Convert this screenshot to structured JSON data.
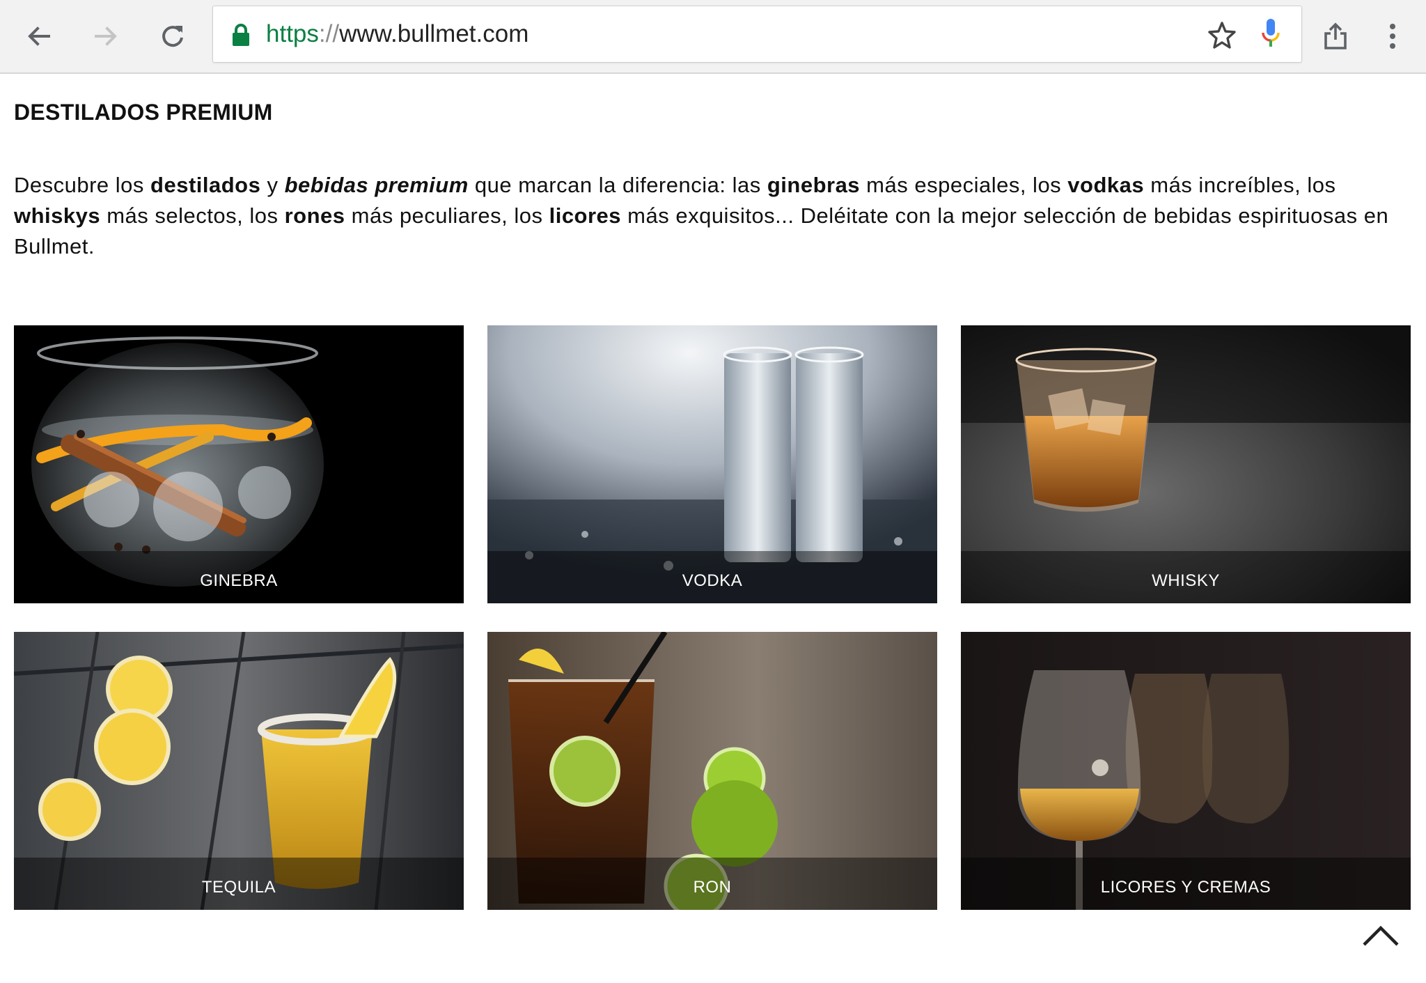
{
  "browser": {
    "url_scheme": "https",
    "url_separator": "://",
    "url_host": "www.bullmet.com",
    "icons": {
      "back": "arrow-left",
      "forward": "arrow-right",
      "reload": "refresh",
      "lock": "padlock",
      "bookmark": "star-outline",
      "voice": "microphone",
      "share": "share-up",
      "menu": "three-dots-vertical"
    },
    "colors": {
      "secure": "#0b8043",
      "toolbar_bg": "#f2f2f2"
    }
  },
  "page": {
    "title": "DESTILADOS PREMIUM",
    "intro": {
      "p1": "Descubre los ",
      "b1": "destilados",
      "p2": " y ",
      "bi1": "bebidas premium",
      "p3": " que marcan la diferencia: las ",
      "b2": "ginebras",
      "p4": " más especiales, los ",
      "b3": "vodkas",
      "p5": " más increíbles, los ",
      "b4": "whiskys",
      "p6": " más selectos, los ",
      "b5": "rones",
      "p7": " más peculiares, los ",
      "b6": "licores",
      "p8": " más exquisitos... Deléitate con la mejor selección de bebidas espirituosas en Bullmet."
    },
    "categories": [
      {
        "label": "GINEBRA"
      },
      {
        "label": "VODKA"
      },
      {
        "label": "WHISKY"
      },
      {
        "label": "TEQUILA"
      },
      {
        "label": "RON"
      },
      {
        "label": "LICORES Y CREMAS"
      }
    ],
    "back_to_top_icon": "chevron-up"
  }
}
